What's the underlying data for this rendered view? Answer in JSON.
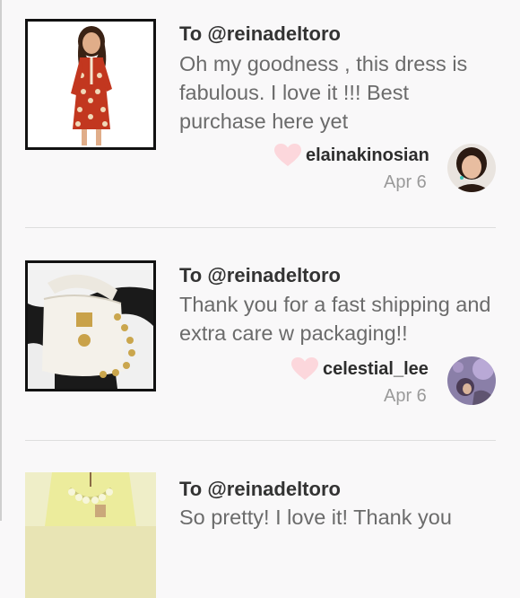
{
  "reviews": [
    {
      "to": "To @reinadeltoro",
      "message": "Oh my goodness , this dress is fabulous. I love it !!! Best purchase here yet",
      "username": "elainakinosian",
      "date": "Apr 6",
      "image_icon": "dress-photo",
      "avatar_icon": "avatar-photo"
    },
    {
      "to": "To @reinadeltoro",
      "message": "Thank you for a fast shipping and extra care w packaging!!",
      "username": "celestial_lee",
      "date": "Apr 6",
      "image_icon": "handbag-photo",
      "avatar_icon": "avatar-photo"
    },
    {
      "to": "To @reinadeltoro",
      "message": "So pretty! I love it! Thank you",
      "image_icon": "blouse-photo"
    }
  ],
  "colors": {
    "heart": "#fcd7dc",
    "background": "#f9f8f9"
  }
}
